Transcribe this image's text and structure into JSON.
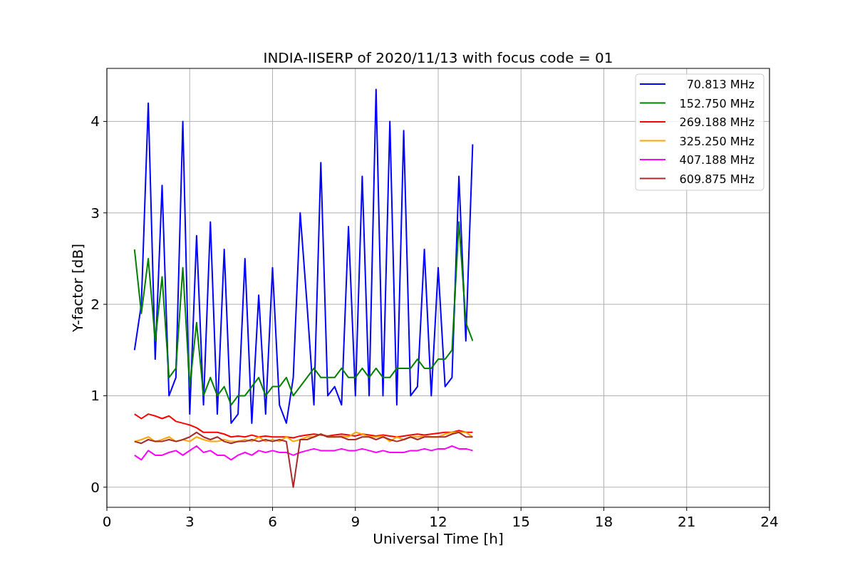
{
  "figure": {
    "chart_data": {
      "type": "line",
      "title": "INDIA-IISERP of 2020/11/13 with focus code = 01",
      "xlabel": "Universal Time [h]",
      "ylabel": "Y-factor [dB]",
      "x": [
        1,
        1.25,
        1.5,
        1.75,
        2,
        2.25,
        2.5,
        2.75,
        3,
        3.25,
        3.5,
        3.75,
        4,
        4.25,
        4.5,
        4.75,
        5,
        5.25,
        5.5,
        5.75,
        6,
        6.25,
        6.5,
        6.75,
        7,
        7.25,
        7.5,
        7.75,
        8,
        8.25,
        8.5,
        8.75,
        9,
        9.25,
        9.5,
        9.75,
        10,
        10.25,
        10.5,
        10.75,
        11,
        11.25,
        11.5,
        11.75,
        12,
        12.25,
        12.5,
        12.75,
        13,
        13.25
      ],
      "series": [
        {
          "name": "70.813 MHz",
          "color": "#0000ff",
          "values": [
            1.5,
            2.0,
            4.2,
            1.4,
            3.3,
            1.0,
            1.2,
            4.0,
            0.8,
            2.75,
            0.9,
            2.9,
            0.8,
            2.6,
            0.7,
            0.8,
            2.5,
            0.7,
            2.1,
            0.8,
            2.4,
            0.9,
            0.7,
            1.2,
            3.0,
            2.0,
            0.9,
            3.55,
            1.0,
            1.1,
            0.9,
            2.85,
            1.0,
            3.4,
            1.0,
            4.35,
            1.0,
            4.0,
            0.9,
            3.9,
            1.0,
            1.1,
            2.6,
            1.0,
            2.4,
            1.1,
            1.2,
            3.4,
            1.6,
            3.75
          ]
        },
        {
          "name": "152.750 MHz",
          "color": "#008000",
          "values": [
            2.6,
            1.9,
            2.5,
            1.6,
            2.3,
            1.2,
            1.3,
            2.4,
            1.1,
            1.8,
            1.0,
            1.2,
            1.0,
            1.1,
            0.9,
            1.0,
            1.0,
            1.1,
            1.2,
            1.0,
            1.1,
            1.1,
            1.2,
            1.0,
            1.1,
            1.2,
            1.3,
            1.2,
            1.2,
            1.2,
            1.3,
            1.2,
            1.2,
            1.3,
            1.2,
            1.3,
            1.2,
            1.2,
            1.3,
            1.3,
            1.3,
            1.4,
            1.3,
            1.3,
            1.4,
            1.4,
            1.5,
            2.9,
            1.8,
            1.6
          ]
        },
        {
          "name": "269.188 MHz",
          "color": "#ff0000",
          "values": [
            0.8,
            0.75,
            0.8,
            0.78,
            0.75,
            0.78,
            0.72,
            0.7,
            0.68,
            0.65,
            0.6,
            0.6,
            0.6,
            0.58,
            0.55,
            0.56,
            0.55,
            0.57,
            0.55,
            0.56,
            0.55,
            0.55,
            0.55,
            0.54,
            0.56,
            0.57,
            0.58,
            0.57,
            0.56,
            0.57,
            0.58,
            0.57,
            0.56,
            0.58,
            0.57,
            0.56,
            0.57,
            0.56,
            0.55,
            0.56,
            0.57,
            0.58,
            0.57,
            0.58,
            0.59,
            0.6,
            0.6,
            0.62,
            0.6,
            0.6
          ]
        },
        {
          "name": "325.250 MHz",
          "color": "#ffa500",
          "values": [
            0.5,
            0.52,
            0.55,
            0.5,
            0.52,
            0.55,
            0.5,
            0.52,
            0.5,
            0.55,
            0.52,
            0.5,
            0.5,
            0.52,
            0.5,
            0.5,
            0.52,
            0.5,
            0.55,
            0.5,
            0.52,
            0.5,
            0.55,
            0.5,
            0.52,
            0.55,
            0.55,
            0.58,
            0.55,
            0.55,
            0.56,
            0.55,
            0.6,
            0.58,
            0.55,
            0.55,
            0.56,
            0.5,
            0.55,
            0.52,
            0.55,
            0.55,
            0.56,
            0.55,
            0.55,
            0.58,
            0.6,
            0.6,
            0.6,
            0.55
          ]
        },
        {
          "name": "407.188 MHz",
          "color": "#ff00ff",
          "values": [
            0.35,
            0.3,
            0.4,
            0.35,
            0.35,
            0.38,
            0.4,
            0.35,
            0.4,
            0.45,
            0.38,
            0.4,
            0.35,
            0.35,
            0.3,
            0.35,
            0.38,
            0.35,
            0.4,
            0.38,
            0.4,
            0.38,
            0.38,
            0.35,
            0.38,
            0.4,
            0.42,
            0.4,
            0.4,
            0.4,
            0.42,
            0.4,
            0.4,
            0.42,
            0.4,
            0.38,
            0.4,
            0.38,
            0.38,
            0.38,
            0.4,
            0.4,
            0.42,
            0.4,
            0.42,
            0.42,
            0.45,
            0.42,
            0.42,
            0.4
          ]
        },
        {
          "name": "609.875 MHz",
          "color": "#a52a2a",
          "values": [
            0.5,
            0.48,
            0.52,
            0.5,
            0.5,
            0.52,
            0.5,
            0.52,
            0.55,
            0.6,
            0.55,
            0.52,
            0.55,
            0.5,
            0.48,
            0.5,
            0.5,
            0.52,
            0.5,
            0.52,
            0.5,
            0.52,
            0.5,
            0.0,
            0.52,
            0.52,
            0.55,
            0.58,
            0.55,
            0.55,
            0.55,
            0.52,
            0.52,
            0.55,
            0.55,
            0.52,
            0.55,
            0.52,
            0.5,
            0.52,
            0.55,
            0.52,
            0.55,
            0.55,
            0.55,
            0.55,
            0.58,
            0.6,
            0.55,
            0.55
          ]
        }
      ],
      "xlim": [
        0,
        24
      ],
      "ylim": [
        -0.22,
        4.58
      ],
      "xticks": [
        0,
        3,
        6,
        9,
        12,
        15,
        18,
        21,
        24
      ],
      "yticks": [
        0,
        1,
        2,
        3,
        4
      ],
      "grid": true,
      "legend": "upper right"
    }
  }
}
